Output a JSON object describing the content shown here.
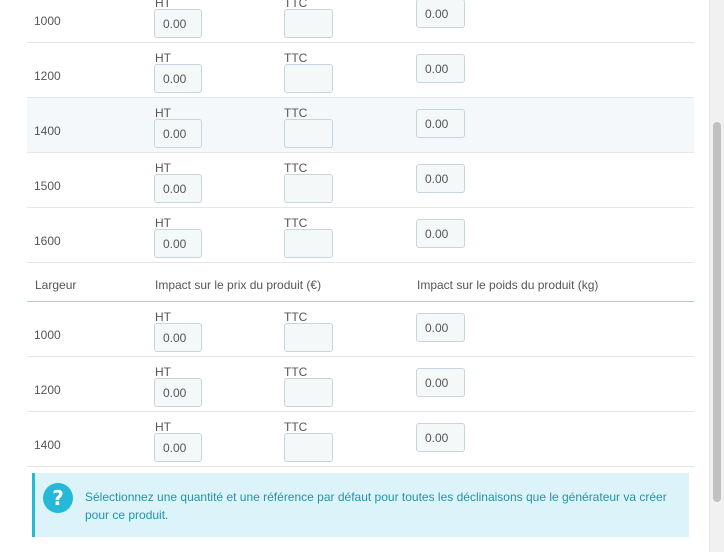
{
  "labels": {
    "ht": "HT",
    "ttc": "TTC"
  },
  "group1": {
    "rows": [
      {
        "value": "1000",
        "ht": "0.00",
        "ttc": "",
        "weight": "0.00"
      },
      {
        "value": "1200",
        "ht": "0.00",
        "ttc": "",
        "weight": "0.00"
      },
      {
        "value": "1400",
        "ht": "0.00",
        "ttc": "",
        "weight": "0.00"
      },
      {
        "value": "1500",
        "ht": "0.00",
        "ttc": "",
        "weight": "0.00"
      },
      {
        "value": "1600",
        "ht": "0.00",
        "ttc": "",
        "weight": "0.00"
      }
    ]
  },
  "group2": {
    "header": {
      "name": "Largeur",
      "price": "Impact sur le prix du produit (€)",
      "weight": "Impact sur le poids du produit (kg)"
    },
    "rows": [
      {
        "value": "1000",
        "ht": "0.00",
        "ttc": "",
        "weight": "0.00"
      },
      {
        "value": "1200",
        "ht": "0.00",
        "ttc": "",
        "weight": "0.00"
      },
      {
        "value": "1400",
        "ht": "0.00",
        "ttc": "",
        "weight": "0.00"
      }
    ]
  },
  "alert": {
    "icon": "question-circle-icon",
    "message": "Sélectionnez une quantité et une référence par défaut pour toutes les déclinaisons que le générateur va créer pour ce produit."
  },
  "colors": {
    "accent": "#25b9d7",
    "alert_bg": "#dcf4f9",
    "alert_text": "#1e94ab",
    "highlight_row": "#f4f8fb"
  }
}
